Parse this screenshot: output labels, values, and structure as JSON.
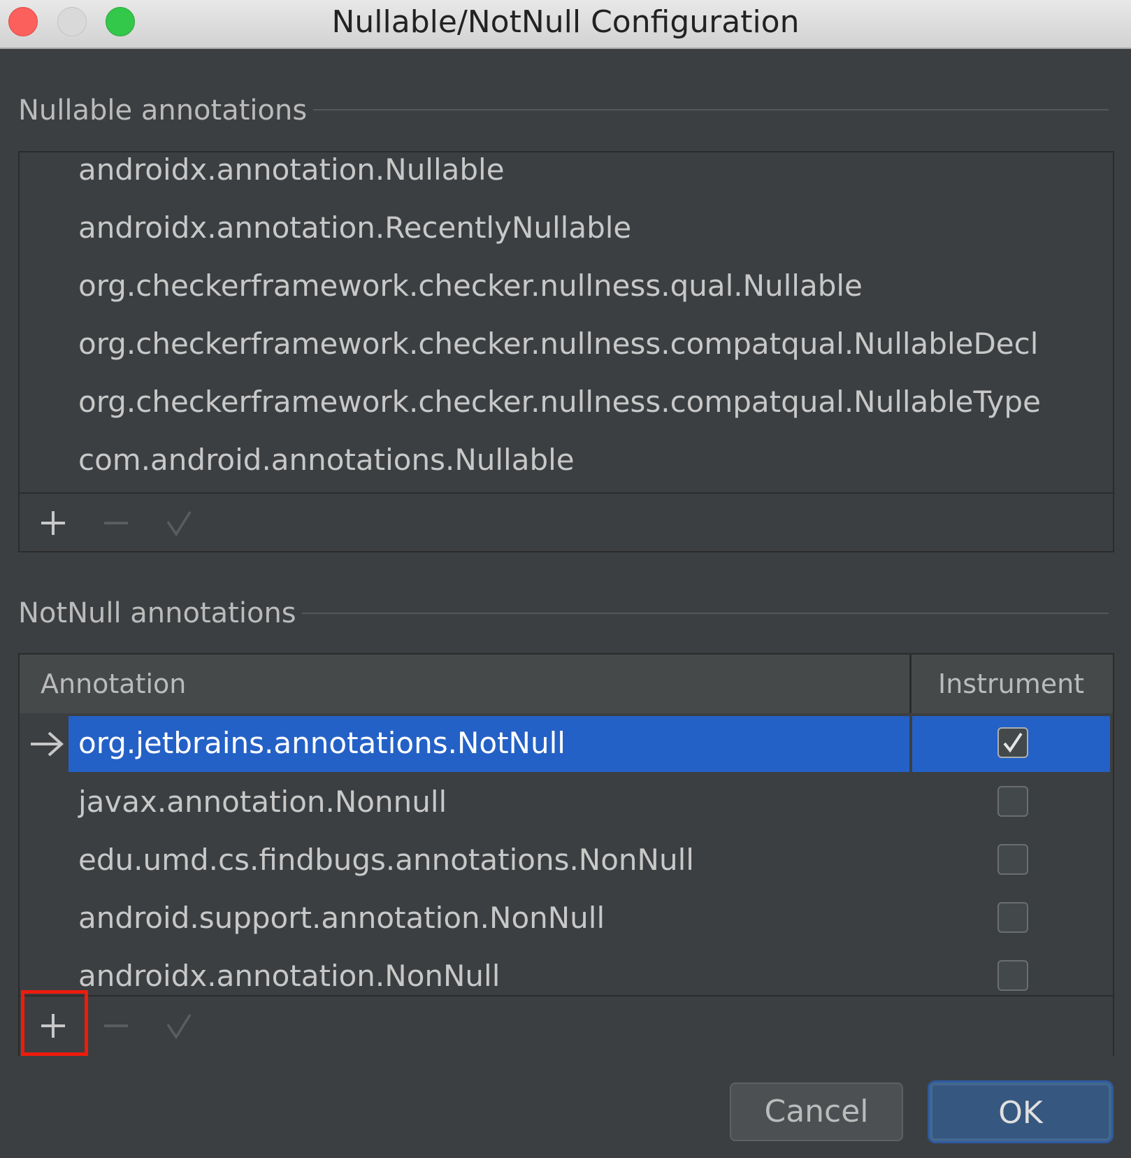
{
  "window": {
    "title": "Nullable/NotNull Configuration"
  },
  "nullable": {
    "section_title": "Nullable annotations",
    "items": [
      "androidx.annotation.Nullable",
      "androidx.annotation.RecentlyNullable",
      "org.checkerframework.checker.nullness.qual.Nullable",
      "org.checkerframework.checker.nullness.compatqual.NullableDecl",
      "org.checkerframework.checker.nullness.compatqual.NullableType",
      "com.android.annotations.Nullable"
    ],
    "toolbar": {
      "add_icon": "plus-icon",
      "remove_icon": "minus-icon",
      "default_icon": "check-icon"
    }
  },
  "notnull": {
    "section_title": "NotNull annotations",
    "columns": [
      "Annotation",
      "Instrument"
    ],
    "rows": [
      {
        "annotation": "org.jetbrains.annotations.NotNull",
        "instrument": true,
        "selected": true
      },
      {
        "annotation": "javax.annotation.Nonnull",
        "instrument": false,
        "selected": false
      },
      {
        "annotation": "edu.umd.cs.findbugs.annotations.NonNull",
        "instrument": false,
        "selected": false
      },
      {
        "annotation": "android.support.annotation.NonNull",
        "instrument": false,
        "selected": false
      },
      {
        "annotation": "androidx.annotation.NonNull",
        "instrument": false,
        "selected": false
      }
    ],
    "toolbar": {
      "add_icon": "plus-icon",
      "remove_icon": "minus-icon",
      "default_icon": "check-icon"
    }
  },
  "buttons": {
    "cancel": "Cancel",
    "ok": "OK"
  },
  "colors": {
    "background": "#3c3f41",
    "selection": "#2461c6",
    "highlight": "#ee1c0d",
    "ok_button": "#365880"
  }
}
